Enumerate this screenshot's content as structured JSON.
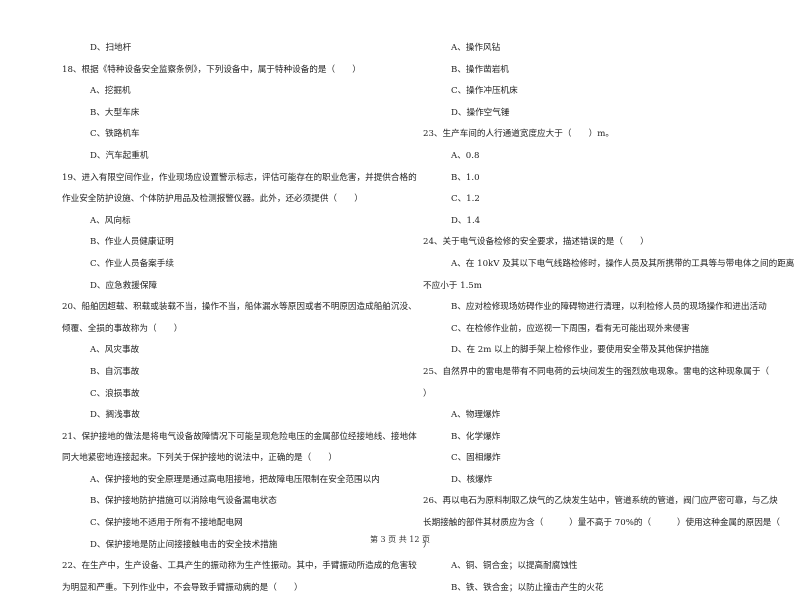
{
  "page": {
    "footer": "第 3 页 共 12 页"
  },
  "left_column": [
    {
      "type": "opt",
      "text": "D、扫地杆"
    },
    {
      "type": "q",
      "text": "18、根据《特种设备安全监察条例》，下列设备中，属于特种设备的是（　　）"
    },
    {
      "type": "opt",
      "text": "A、挖掘机"
    },
    {
      "type": "opt",
      "text": "B、大型车床"
    },
    {
      "type": "opt",
      "text": "C、铁路机车"
    },
    {
      "type": "opt",
      "text": "D、汽车起重机"
    },
    {
      "type": "q",
      "text": "19、进入有限空间作业，作业现场应设置警示标志，评估可能存在的职业危害，并提供合格的"
    },
    {
      "type": "qcont",
      "text": "作业安全防护设施、个体防护用品及检测报警仪器。此外，还必须提供（　　）"
    },
    {
      "type": "opt",
      "text": "A、风向标"
    },
    {
      "type": "opt",
      "text": "B、作业人员健康证明"
    },
    {
      "type": "opt",
      "text": "C、作业人员备案手续"
    },
    {
      "type": "opt",
      "text": "D、应急救援保障"
    },
    {
      "type": "q",
      "text": "20、船舶因超载、积载或装载不当，操作不当，船体漏水等原因或者不明原因造成船舶沉没、"
    },
    {
      "type": "qcont",
      "text": "倾覆、全损的事故称为（　　）"
    },
    {
      "type": "opt",
      "text": "A、风灾事故"
    },
    {
      "type": "opt",
      "text": "B、自沉事故"
    },
    {
      "type": "opt",
      "text": "C、浪损事故"
    },
    {
      "type": "opt",
      "text": "D、搁浅事故"
    },
    {
      "type": "q",
      "text": "21、保护接地的做法是将电气设备故障情况下可能呈现危险电压的金属部位经接地线、接地体"
    },
    {
      "type": "qcont",
      "text": "同大地紧密地连接起来。下列关于保护接地的说法中，正确的是（　　）"
    },
    {
      "type": "opt",
      "text": "A、保护接地的安全原理是通过高电阻接地，把故障电压限制在安全范围以内"
    },
    {
      "type": "opt",
      "text": "B、保护接地防护措施可以消除电气设备漏电状态"
    },
    {
      "type": "opt",
      "text": "C、保护接地不适用于所有不接地配电网"
    },
    {
      "type": "opt",
      "text": "D、保护接地是防止间接接触电击的安全技术措施"
    },
    {
      "type": "q",
      "text": "22、在生产中，生产设备、工具产生的振动称为生产性振动。其中，手臂振动所造成的危害较"
    },
    {
      "type": "qcont",
      "text": "为明显和严重。下列作业中，不会导致手臂振动病的是（　　）"
    }
  ],
  "right_column": [
    {
      "type": "opt",
      "text": "A、操作风钻"
    },
    {
      "type": "opt",
      "text": "B、操作凿岩机"
    },
    {
      "type": "opt",
      "text": "C、操作冲压机床"
    },
    {
      "type": "opt",
      "text": "D、操作空气锤"
    },
    {
      "type": "q",
      "text": "23、生产车间的人行通道宽度应大于（　　）m。"
    },
    {
      "type": "opt",
      "text": "A、0.8"
    },
    {
      "type": "opt",
      "text": "B、1.0"
    },
    {
      "type": "opt",
      "text": "C、1.2"
    },
    {
      "type": "opt",
      "text": "D、1.4"
    },
    {
      "type": "q",
      "text": "24、关于电气设备检修的安全要求，描述错误的是（　　）"
    },
    {
      "type": "opt",
      "text": "A、在 10kV 及其以下电气线路检修时，操作人员及其所携带的工具等与带电体之间的距离"
    },
    {
      "type": "qcont",
      "text": "不应小于 1.5m"
    },
    {
      "type": "opt",
      "text": "B、应对检修现场妨碍作业的障碍物进行清理，以利检修人员的现场操作和进出活动"
    },
    {
      "type": "opt",
      "text": "C、在检修作业前，应巡视一下周围，看有无可能出现外来侵害"
    },
    {
      "type": "opt",
      "text": "D、在 2m 以上的脚手架上检修作业，要使用安全带及其他保护措施"
    },
    {
      "type": "q",
      "text": "25、自然界中的雷电是带有不同电荷的云块间发生的强烈放电现象。雷电的这种现象属于（"
    },
    {
      "type": "qcont",
      "text": "）"
    },
    {
      "type": "opt",
      "text": "A、物理爆炸"
    },
    {
      "type": "opt",
      "text": "B、化学爆炸"
    },
    {
      "type": "opt",
      "text": "C、固相爆炸"
    },
    {
      "type": "opt",
      "text": "D、核爆炸"
    },
    {
      "type": "q",
      "text": "26、再以电石为原料制取乙炔气的乙炔发生站中，管道系统的管道，阀门应严密可靠，与乙炔"
    },
    {
      "type": "qcont",
      "text": "长期接触的部件其材质应为含（　　　）量不高于 70%的（　　　）使用这种金属的原因是（"
    },
    {
      "type": "qcont",
      "text": "）"
    },
    {
      "type": "opt",
      "text": "A、铜、铜合金；以提高耐腐蚀性"
    },
    {
      "type": "opt",
      "text": "B、铁、铁合金；以防止撞击产生的火花"
    }
  ]
}
